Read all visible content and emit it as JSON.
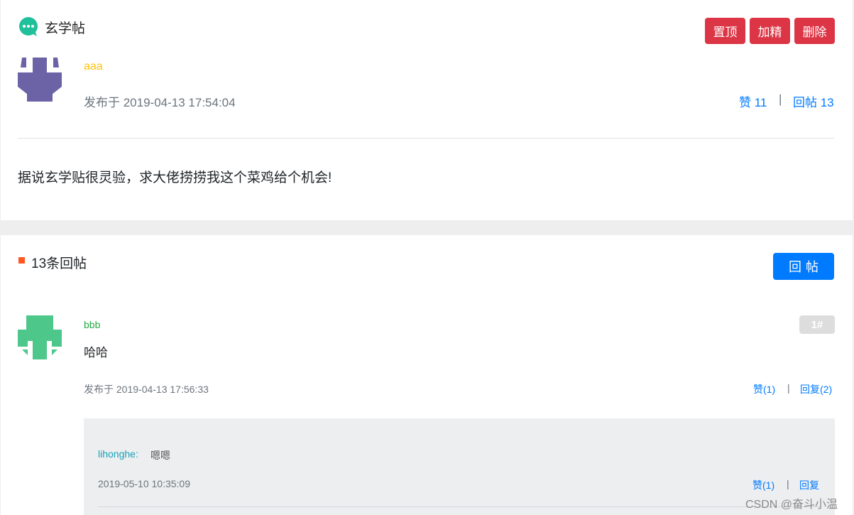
{
  "post": {
    "title": "玄学帖",
    "buttons": {
      "pin": "置顶",
      "feature": "加精",
      "delete": "删除"
    },
    "author": "aaa",
    "published": "发布于 2019-04-13 17:54:04",
    "likes": "赞 11",
    "separator": "|",
    "replies": "回帖 13",
    "content": "据说玄学贴很灵验，求大佬捞捞我这个菜鸡给个机会!"
  },
  "replies_section": {
    "heading": "13条回帖",
    "reply_button": "回帖",
    "items": [
      {
        "author": "bbb",
        "floor": "1#",
        "content": "哈哈",
        "published": "发布于 2019-04-13 17:56:33",
        "likes": "赞(1)",
        "separator": "|",
        "reply_link": "回复(2)",
        "comments": [
          {
            "author": "lihonghe:",
            "content": "嗯嗯",
            "time": "2019-05-10 10:35:09",
            "likes": "赞(1)",
            "separator": "|",
            "reply_link": "回复"
          }
        ]
      }
    ]
  },
  "colors": {
    "danger": "#dc3545",
    "primary": "#007bff",
    "author_main": "#ffc107",
    "author_reply": "#28a745",
    "comment_author": "#17a2b8",
    "accent_square": "#ff5722",
    "chat_icon": "#20c09a"
  },
  "watermark": "CSDN @奋斗小温"
}
